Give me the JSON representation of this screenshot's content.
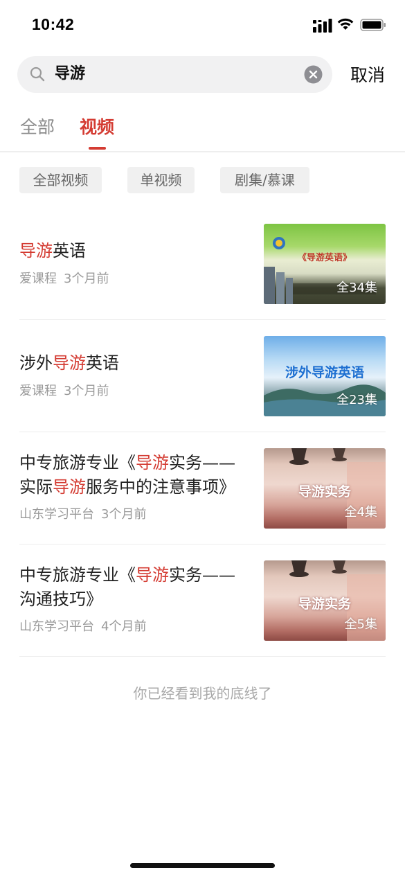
{
  "status_bar": {
    "time": "10:42"
  },
  "search": {
    "query": "导游",
    "cancel_label": "取消"
  },
  "tabs": [
    {
      "label": "全部",
      "active": false
    },
    {
      "label": "视频",
      "active": true
    }
  ],
  "filters": [
    {
      "label": "全部视频"
    },
    {
      "label": "单视频"
    },
    {
      "label": "剧集/慕课"
    }
  ],
  "items": [
    {
      "title_parts": [
        {
          "text": "导游",
          "highlight": true
        },
        {
          "text": "英语",
          "highlight": false
        }
      ],
      "source": "爱课程",
      "time": "3个月前",
      "episodes": "全34集",
      "thumb_text": "《导游英语》"
    },
    {
      "title_parts": [
        {
          "text": "涉外",
          "highlight": false
        },
        {
          "text": "导游",
          "highlight": true
        },
        {
          "text": "英语",
          "highlight": false
        }
      ],
      "source": "爱课程",
      "time": "3个月前",
      "episodes": "全23集",
      "thumb_text": "涉外导游英语"
    },
    {
      "title_parts": [
        {
          "text": "中专旅游专业《",
          "highlight": false
        },
        {
          "text": "导游",
          "highlight": true
        },
        {
          "text": "实务——实际",
          "highlight": false
        },
        {
          "text": "导游",
          "highlight": true
        },
        {
          "text": "服务中的注意事项》",
          "highlight": false
        }
      ],
      "source": "山东学习平台",
      "time": "3个月前",
      "episodes": "全4集",
      "thumb_text": "导游实务"
    },
    {
      "title_parts": [
        {
          "text": "中专旅游专业《",
          "highlight": false
        },
        {
          "text": "导游",
          "highlight": true
        },
        {
          "text": "实务——沟通技巧》",
          "highlight": false
        }
      ],
      "source": "山东学习平台",
      "time": "4个月前",
      "episodes": "全5集",
      "thumb_text": "导游实务"
    }
  ],
  "footer": {
    "end_text": "你已经看到我的底线了"
  },
  "colors": {
    "accent": "#d43c33",
    "muted": "#9a9a9a",
    "chip_bg": "#f0f0f0"
  }
}
